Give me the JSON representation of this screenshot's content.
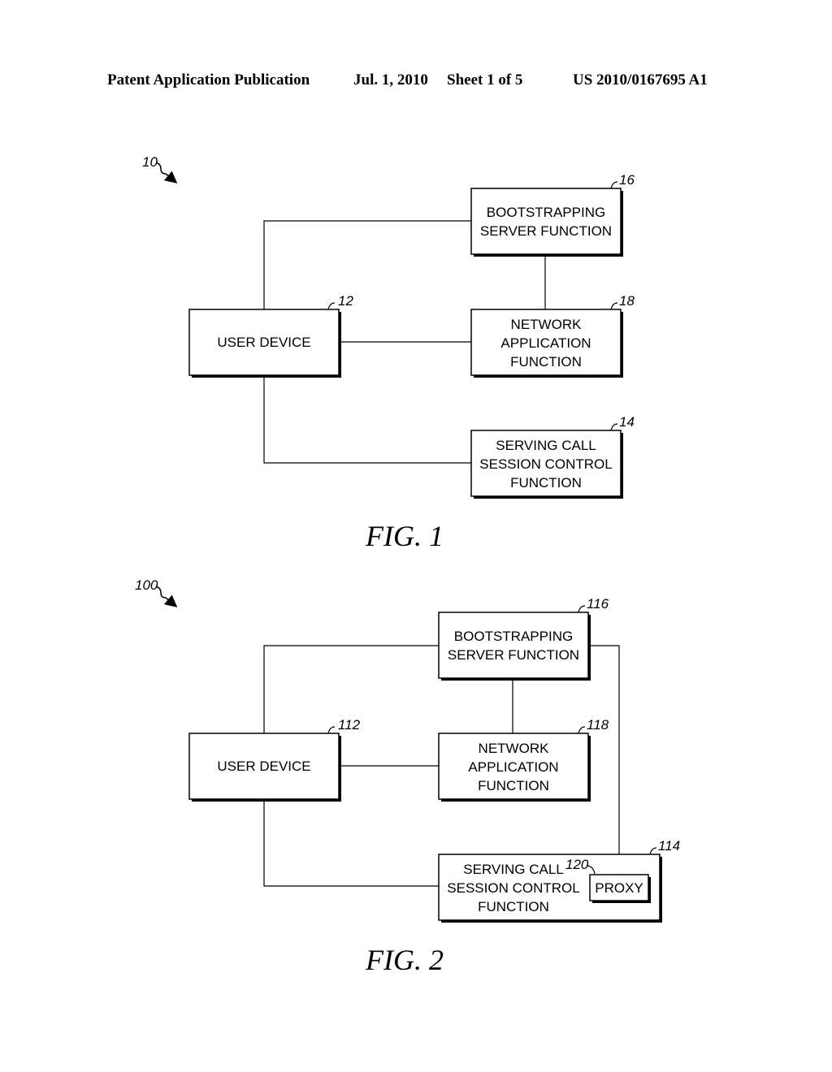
{
  "header": {
    "left": "Patent Application Publication",
    "date": "Jul. 1, 2010",
    "sheet": "Sheet 1 of 5",
    "number": "US 2010/0167695 A1"
  },
  "fig1": {
    "caption": "FIG. 1",
    "ref": "10",
    "bsf": {
      "ref": "16",
      "lines": [
        "BOOTSTRAPPING",
        "SERVER FUNCTION"
      ]
    },
    "ud": {
      "ref": "12",
      "lines": [
        "USER DEVICE"
      ]
    },
    "naf": {
      "ref": "18",
      "lines": [
        "NETWORK",
        "APPLICATION",
        "FUNCTION"
      ]
    },
    "scscf": {
      "ref": "14",
      "lines": [
        "SERVING CALL",
        "SESSION CONTROL",
        "FUNCTION"
      ]
    }
  },
  "fig2": {
    "caption": "FIG. 2",
    "ref": "100",
    "bsf": {
      "ref": "116",
      "lines": [
        "BOOTSTRAPPING",
        "SERVER FUNCTION"
      ]
    },
    "ud": {
      "ref": "112",
      "lines": [
        "USER DEVICE"
      ]
    },
    "naf": {
      "ref": "118",
      "lines": [
        "NETWORK",
        "APPLICATION",
        "FUNCTION"
      ]
    },
    "scscf": {
      "ref": "114",
      "lines": [
        "SERVING CALL",
        "SESSION CONTROL",
        "FUNCTION"
      ]
    },
    "proxy": {
      "ref": "120",
      "lines": [
        "PROXY"
      ]
    }
  }
}
